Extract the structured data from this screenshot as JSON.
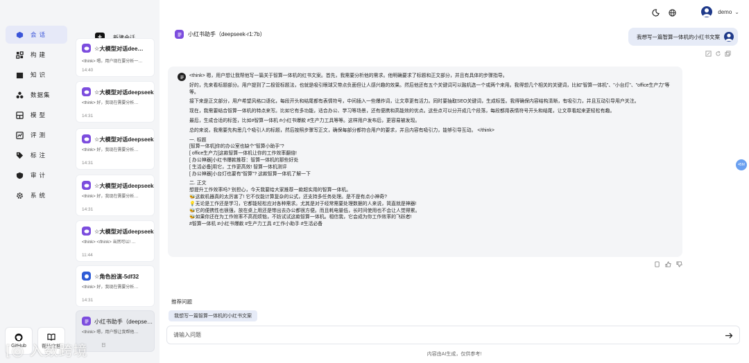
{
  "nav": {
    "items": [
      {
        "label": "会话",
        "icon": "cube-icon"
      },
      {
        "label": "构建",
        "icon": "build-icon"
      },
      {
        "label": "知识",
        "icon": "book-icon"
      },
      {
        "label": "数据集",
        "icon": "dataset-icon"
      },
      {
        "label": "模型",
        "icon": "model-icon"
      },
      {
        "label": "评测",
        "icon": "evaluate-icon"
      },
      {
        "label": "标注",
        "icon": "tag-icon"
      },
      {
        "label": "审计",
        "icon": "shield-icon"
      },
      {
        "label": "系统",
        "icon": "gear-icon"
      }
    ],
    "bottom": [
      {
        "label": "GitHub",
        "icon": "github-icon"
      },
      {
        "label": "帮助文档",
        "icon": "book-open-icon"
      }
    ]
  },
  "sessions": {
    "new_chat_label": "新建会话",
    "items": [
      {
        "title": "☆大模型对话dee…",
        "preview": "<think> 嗯。用户现在要分析一…",
        "time": "14:40"
      },
      {
        "title": "☆大模型对话deepseek",
        "preview": "<think> 好，我现在需要分析…",
        "time": "14:31"
      },
      {
        "title": "☆大模型对话deepseek",
        "preview": "<think> 好，我现在需要分析…",
        "time": "14:31"
      },
      {
        "title": "☆大模型对话deepseek",
        "preview": "<think> 好，我现在需要分析…",
        "time": "14:31"
      },
      {
        "title": "☆大模型对话deepseek",
        "preview": "<think> </think> 当然可以! …",
        "time": "11:44"
      },
      {
        "title": "☆角色扮演-5df32",
        "preview": "<think> 好，我现在需要分析…",
        "time": "14:31"
      },
      {
        "title": "小红书助手（deepseek-r1:7b）",
        "preview": "<think> 嗯，用户想让我帮他…",
        "time": "日"
      }
    ]
  },
  "topbar": {
    "user_name": "demo",
    "dropdown": "⌄"
  },
  "chat": {
    "title": "小红书助手（deepseek-r1:7b）",
    "user_message": "我想写一篇智算一体机的小红书文案",
    "answer_lines": [
      "<think> 嗯，用户想让我帮他写一篇关于智算一体机的红书文案。首先，我需要分析他的需求。他明确要求了标题和正文部分，并且有具体的步骤指导。",
      "好的，先来看标题部分。用户提到了二极管标题法，也就是吸引眼球又带点负面但让人感兴趣的效果。然后他还有五个关键词可以融机选一个或两个来用。我得想几个相关的关键词，比如\"智算一体机\"、\"小台灯\"、\"office生产力\"等等。",
      "接下来是正文部分，用户希望风格口语化，每段开头和结尾都有表情符号，中间插入一些爆炸词，让文章更有活力。同时要抽取SEO关键词，生成标签。我得确保内容结构清晰，有吸引力，并且互动引导用户关注。",
      "现在，我需要结合智算一体机的特点来写。比如它有多功能，适合办公、学习等场景，还有便携和高能效的优点。这些点可以分开成几个段落，每段都用表情符号开头和结尾，让文章看起来更轻松有趣。",
      "最后，生成合适的标签，比如#智算一体机 #小红书爆款 #生产力工具等等。这样用户发布后，更容易被发现。",
      "总的来说，我需要先构思几个吸引人的标题，然后按照步骤写正文，确保每部分都符合用户的要求，并且内容有吸引力，能够引导互动。 </think>",
      "一. 标题",
      "[智算一体机]你的办公室也缺个\"智算小助手\"?",
      "[ office生产力]这款智算一体机让你的工作效率翻倍!",
      "[ 办公神器]小红书爆款推荐：智算一体机的那些好处",
      "[ 生活必备]用它，工作更高效! 智算一体机测评",
      "[ 办公神器]小台灯也要有\"智算\"? 这款智算一体机了解一下",
      "二. 正文",
      "想提升工作效率吗? 别担心，今天我要给大家推荐一款超实用的智算一体机。",
      "🐝这款机器真的太厉害了! 它不仅能计算复杂的公式，还支持多任务处理。是不是有点小神奇?",
      "💡无论是工作还是学习，它都能轻松应对各种需求。尤其是对于经常需要处理数据的人来说，简直就是神器!",
      "🐝它的便携性也很强，放在桌上用还是带出去办公都很方便。而且耗电量低，长时间使用也不会让人觉得累。",
      "🐝如果你还在为工作效率不高而烦恼，不妨试试这款智算一体机。相信我，它会成为你工作效率的飞跃者!",
      "#智算一体机 #小红书爆款 #生产力工具 #工作小助手 #生活必备"
    ],
    "recommend_label": "推荐问题",
    "recommend_chip": "我想写一篇智算一体机的小红书文案",
    "input_placeholder": "请输入问题",
    "footer": "内容由AI生成，仅供参考!",
    "float_badge": "45M"
  },
  "watermark": "[◎ 入数跨境"
}
